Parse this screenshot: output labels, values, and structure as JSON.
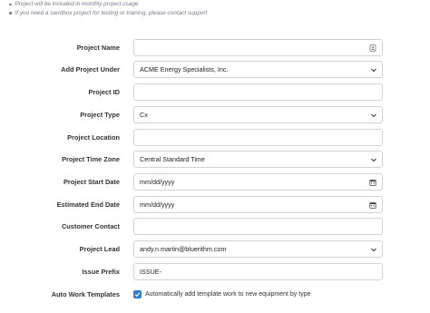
{
  "notes": [
    "Project will be included in monthly project usage",
    "If you need a sandbox project for testing or training, please contact support"
  ],
  "form": {
    "project_name": {
      "label": "Project Name",
      "value": "",
      "icon": "contact-card-icon"
    },
    "add_project_under": {
      "label": "Add Project Under",
      "value": "ACME Energy Specialists, Inc."
    },
    "project_id": {
      "label": "Project ID",
      "value": ""
    },
    "project_type": {
      "label": "Project Type",
      "value": "Cx"
    },
    "project_location": {
      "label": "Project Location",
      "value": ""
    },
    "project_time_zone": {
      "label": "Project Time Zone",
      "value": "Central Standard Time"
    },
    "project_start_date": {
      "label": "Project Start Date",
      "placeholder": "mm/dd/yyyy"
    },
    "estimated_end_date": {
      "label": "Estimated End Date",
      "placeholder": "mm/dd/yyyy"
    },
    "customer_contact": {
      "label": "Customer Contact",
      "value": ""
    },
    "project_lead": {
      "label": "Project Lead",
      "value": "andy.n.martin@bluerithm.com"
    },
    "issue_prefix": {
      "label": "Issue Prefix",
      "value": "ISSUE-"
    },
    "auto_work_templates": {
      "label": "Auto Work Templates",
      "checked": true,
      "text": "Automatically add template work to new equipment by type"
    }
  },
  "colors": {
    "accent": "#2f7cd6",
    "border": "#cfd3d8",
    "label_text": "#333333",
    "note_text": "#7a7a8c"
  }
}
